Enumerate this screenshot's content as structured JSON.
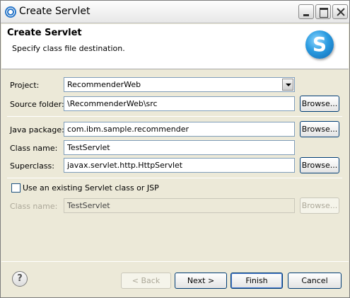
{
  "window": {
    "title": "Create Servlet"
  },
  "banner": {
    "title": "Create Servlet",
    "subtitle": "Specify class file destination.",
    "logo_letter": "S"
  },
  "form": {
    "project": {
      "label": "Project:",
      "value": "RecommenderWeb"
    },
    "source_folder": {
      "label": "Source folder:",
      "value": "\\RecommenderWeb\\src",
      "browse": "Browse..."
    },
    "java_package": {
      "label": "Java package:",
      "value": "com.ibm.sample.recommender",
      "browse": "Browse..."
    },
    "class_name": {
      "label": "Class name:",
      "value": "TestServlet"
    },
    "superclass": {
      "label": "Superclass:",
      "value": "javax.servlet.http.HttpServlet",
      "browse": "Browse..."
    },
    "existing_servlet": {
      "label": "Use an existing Servlet class or JSP",
      "checked": false
    },
    "existing_class_name": {
      "label": "Class name:",
      "value": "TestServlet",
      "browse": "Browse..."
    }
  },
  "footer": {
    "help_icon": "question-mark-icon",
    "back": "< Back",
    "next": "Next >",
    "finish": "Finish",
    "cancel": "Cancel"
  }
}
